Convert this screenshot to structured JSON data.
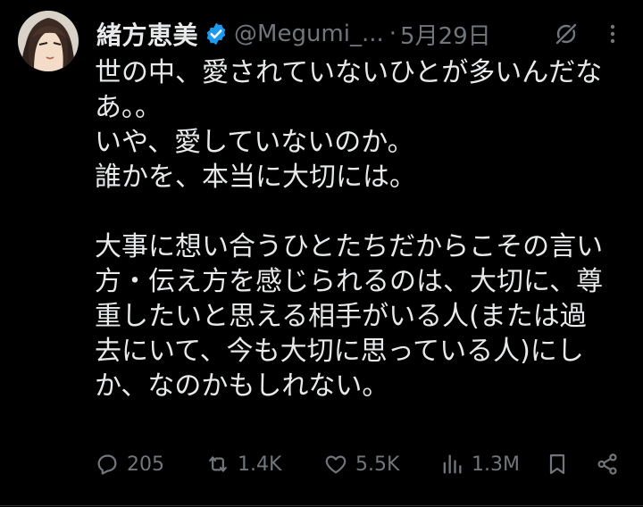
{
  "colors": {
    "background": "#000000",
    "text_primary": "#e7e9ea",
    "text_secondary": "#71767b",
    "verified_blue": "#1d9bf0"
  },
  "author": {
    "display_name": "緒方恵美",
    "handle": "@Megumi_...",
    "separator": "·",
    "date": "5月29日",
    "verified": true
  },
  "tweet": {
    "lines": [
      "世の中、愛されていないひとが多いんだな",
      "あ。。",
      "いや、愛していないのか。",
      "誰かを、本当に大切には。",
      "",
      "大事に想い合うひとたちだからこその言い",
      "方・伝え方を感じられるのは、大切に、尊",
      "重したいと思える相手がいる人(または過",
      "去にいて、今も大切に思っている人)にし",
      "か、なのかもしれない。"
    ]
  },
  "actions": {
    "reply_count": "205",
    "retweet_count": "1.4K",
    "like_count": "5.5K",
    "view_count": "1.3M"
  },
  "icons": {
    "top_right": [
      "grok-icon",
      "more-icon"
    ],
    "action_bar": [
      "reply-icon",
      "retweet-icon",
      "like-icon",
      "views-icon",
      "bookmark-icon",
      "share-icon"
    ]
  }
}
